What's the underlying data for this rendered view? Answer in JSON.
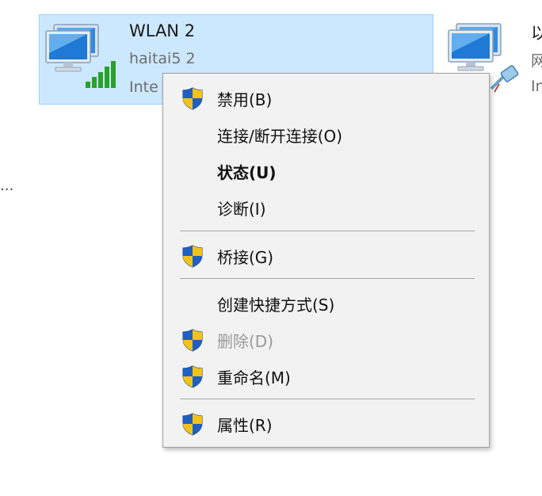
{
  "adapters": {
    "wlan": {
      "name": "WLAN 2",
      "network": "haitai5 2",
      "status": "Inte"
    },
    "ethernet": {
      "name": "以",
      "line2": "网",
      "line3": "In"
    }
  },
  "left_edge_text": "...",
  "context_menu": {
    "items": [
      {
        "label": "禁用(B)",
        "icon": "uac-shield-icon",
        "enabled": true,
        "bold": false
      },
      {
        "label": "连接/断开连接(O)",
        "icon": "",
        "enabled": true,
        "bold": false
      },
      {
        "label": "状态(U)",
        "icon": "",
        "enabled": true,
        "bold": true
      },
      {
        "label": "诊断(I)",
        "icon": "",
        "enabled": true,
        "bold": false
      },
      {
        "label": "桥接(G)",
        "icon": "uac-shield-icon",
        "enabled": true,
        "bold": false
      },
      {
        "label": "创建快捷方式(S)",
        "icon": "",
        "enabled": true,
        "bold": false
      },
      {
        "label": "删除(D)",
        "icon": "uac-shield-icon",
        "enabled": false,
        "bold": false
      },
      {
        "label": "重命名(M)",
        "icon": "uac-shield-icon",
        "enabled": true,
        "bold": false
      },
      {
        "label": "属性(R)",
        "icon": "uac-shield-icon",
        "enabled": true,
        "bold": false
      }
    ]
  },
  "colors": {
    "selection_bg": "#cce8ff",
    "selection_border": "#99d1ff",
    "menu_bg": "#f2f2f2",
    "disabled_text": "#9a9a9a"
  }
}
